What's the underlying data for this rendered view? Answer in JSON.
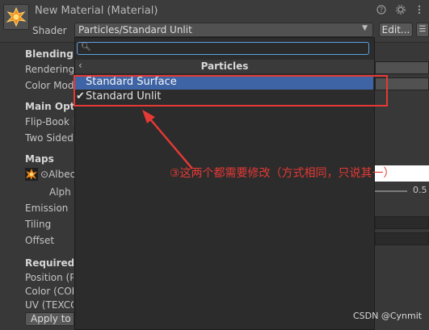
{
  "header": {
    "title": "New Material (Material)",
    "shader_label": "Shader",
    "shader_value": "Particles/Standard Unlit",
    "edit_button": "Edit...",
    "list_icon": "list-icon",
    "help_icon": "help-icon",
    "settings_icon": "settings-icon",
    "menu_icon": "menu-icon",
    "material_icon": "material-icon"
  },
  "inspector": {
    "blending_options": "Blending",
    "rendering_mode": "Rendering",
    "color_mode": "Color Mod",
    "main_options": "Main Opti",
    "flip_book": "Flip-Book I",
    "two_sided": "Two Sided",
    "maps": "Maps",
    "albedo": "Albec",
    "albedo_prefix": "⊙",
    "alpha": "Alph",
    "emission": "Emission",
    "tiling": "Tiling",
    "offset": "Offset",
    "required_streams": "Required",
    "position": "Position (P",
    "color": "Color (COL",
    "uv": "UV (TEXCO",
    "apply_button": "Apply to S",
    "alpha_value": "0.5"
  },
  "popup": {
    "search_value": "",
    "category_title": "Particles",
    "back_icon": "chevron-left-icon",
    "items": [
      {
        "label": "Standard Surface",
        "checked": false,
        "selected": true
      },
      {
        "label": "Standard Unlit",
        "checked": true,
        "selected": false
      }
    ],
    "check_mark": "✔"
  },
  "annotation": {
    "text": "③这两个都需要修改（方式相同，只说其一）",
    "color": "#e53935"
  },
  "watermark": "CSDN @Cynmit",
  "colors": {
    "background": "#383838",
    "popup": "#2c2c2c",
    "selection": "#3e64a6",
    "accent": "#5ea1e0"
  }
}
